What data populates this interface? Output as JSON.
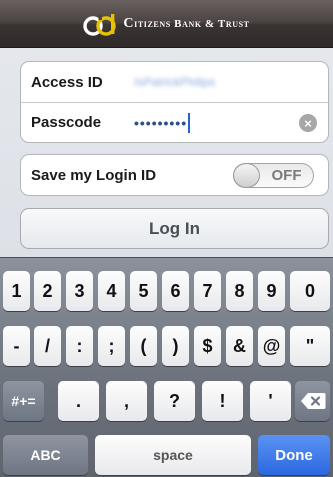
{
  "header": {
    "bank_name_prefix": "C",
    "bank_name_rest": "itizens Bank & Trust",
    "logo_icon": "citizens-logo-mark",
    "bar_color": "#4a4342"
  },
  "form": {
    "access_id_label": "Access ID",
    "access_id_value": "IsPatrickPhilips",
    "passcode_label": "Passcode",
    "passcode_value": "•••••••••",
    "save_login_label": "Save my Login ID",
    "toggle_state": "OFF",
    "login_button_label": "Log In"
  },
  "keyboard": {
    "row1": [
      "1",
      "2",
      "3",
      "4",
      "5",
      "6",
      "7",
      "8",
      "9",
      "0"
    ],
    "row2": [
      "-",
      "/",
      ":",
      ";",
      "(",
      ")",
      "$",
      "&",
      "@",
      "\""
    ],
    "row3": [
      ".",
      ",",
      "?",
      "!",
      "'"
    ],
    "shift_label": "#+=",
    "abc_label": "ABC",
    "space_label": "space",
    "done_label": "Done",
    "accent_color": "#2c68e0"
  }
}
